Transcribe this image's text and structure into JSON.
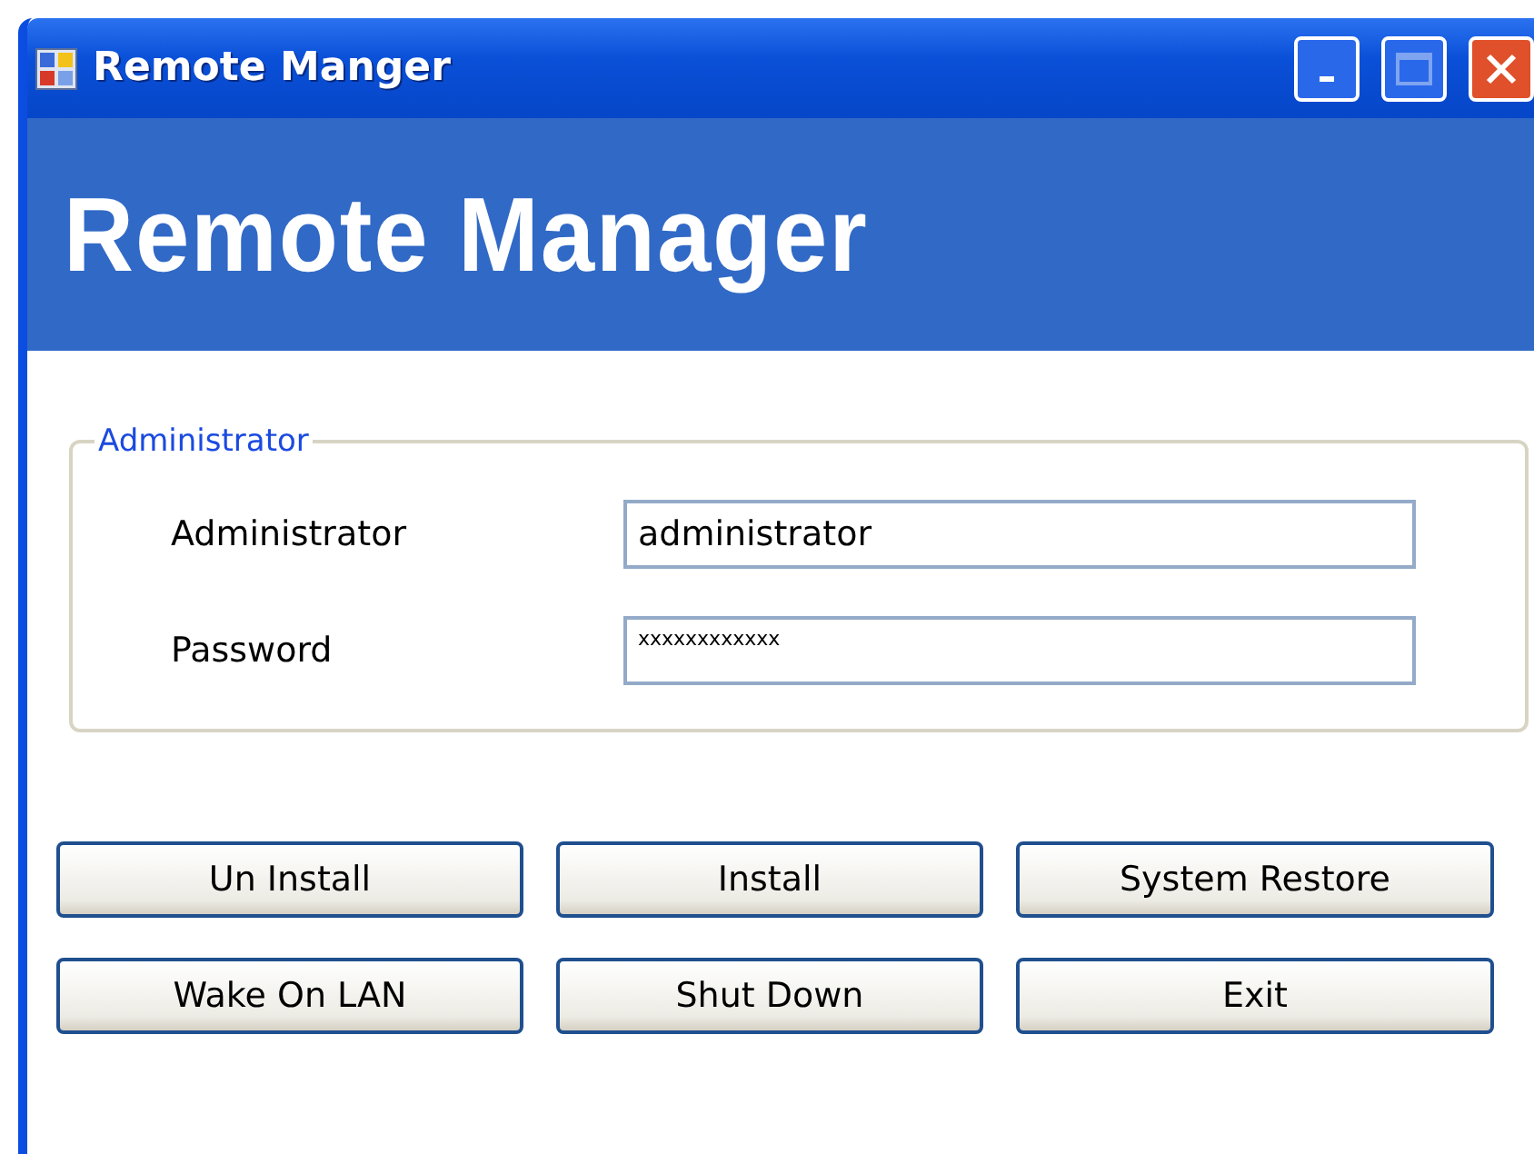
{
  "window": {
    "title": "Remote Manger"
  },
  "header": {
    "title": "Remote Manager"
  },
  "group": {
    "legend": "Administrator",
    "fields": [
      {
        "label": "Administrator",
        "value": "administrator",
        "kind": "text"
      },
      {
        "label": "Password",
        "value": "xxxxxxxxxxxx",
        "kind": "password"
      }
    ]
  },
  "buttons": [
    [
      "Un Install",
      "Install",
      "System Restore"
    ],
    [
      "Wake On LAN",
      "Shut Down",
      "Exit"
    ]
  ]
}
